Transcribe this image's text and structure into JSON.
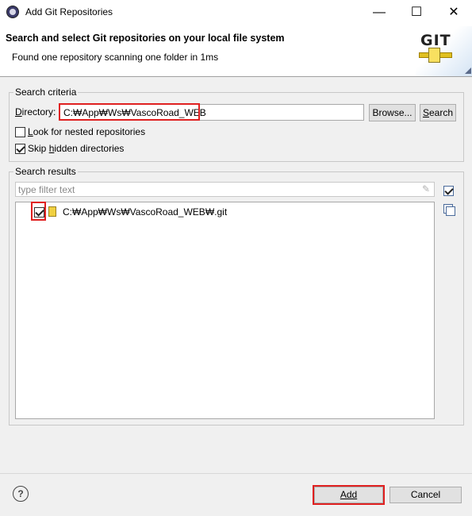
{
  "window": {
    "title": "Add Git Repositories",
    "minimize_glyph": "—",
    "maximize_glyph": "☐",
    "close_glyph": "✕"
  },
  "banner": {
    "title": "Search and select Git repositories on your local file system",
    "subtitle": "Found one repository scanning one folder in 1ms",
    "logo_text": "GIT"
  },
  "search_criteria": {
    "group_label": "Search criteria",
    "directory_label_pre": "D",
    "directory_label_post": "irectory:",
    "directory_value": "C:₩App₩Ws₩VascoRoad_WEB",
    "browse_label": "Browse...",
    "search_label_pre": "S",
    "search_label_post": "earch",
    "nested_label_pre": "L",
    "nested_label_post": "ook for nested repositories",
    "nested_checked": false,
    "skip_label_pre": "Skip ",
    "skip_label_mid": "h",
    "skip_label_post": "idden directories",
    "skip_checked": true
  },
  "search_results": {
    "group_label": "Search results",
    "filter_placeholder": "type filter text",
    "items": [
      {
        "label": "C:₩App₩Ws₩VascoRoad_WEB₩.git",
        "checked": true
      }
    ]
  },
  "footer": {
    "help_glyph": "?",
    "add_label": "Add",
    "cancel_label": "Cancel"
  },
  "colors": {
    "highlight": "#e02020",
    "background": "#f0f0f0"
  }
}
